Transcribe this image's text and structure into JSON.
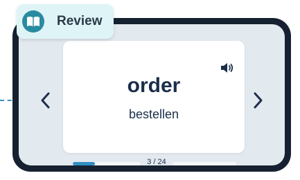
{
  "review_badge": {
    "label": "Review",
    "icon": "open-book-icon"
  },
  "flashcard": {
    "word": "order",
    "translation": "bestellen",
    "audio_icon": "speaker-icon"
  },
  "navigation": {
    "prev_icon": "chevron-left-icon",
    "next_icon": "chevron-right-icon"
  },
  "progress": {
    "current": 3,
    "total": 24,
    "label": "3 / 24"
  },
  "colors": {
    "accent": "#2f8fc4",
    "badge_bg": "#dff4f6",
    "badge_icon": "#2a8ba0",
    "frame": "#152130",
    "text": "#1b2e4b"
  }
}
